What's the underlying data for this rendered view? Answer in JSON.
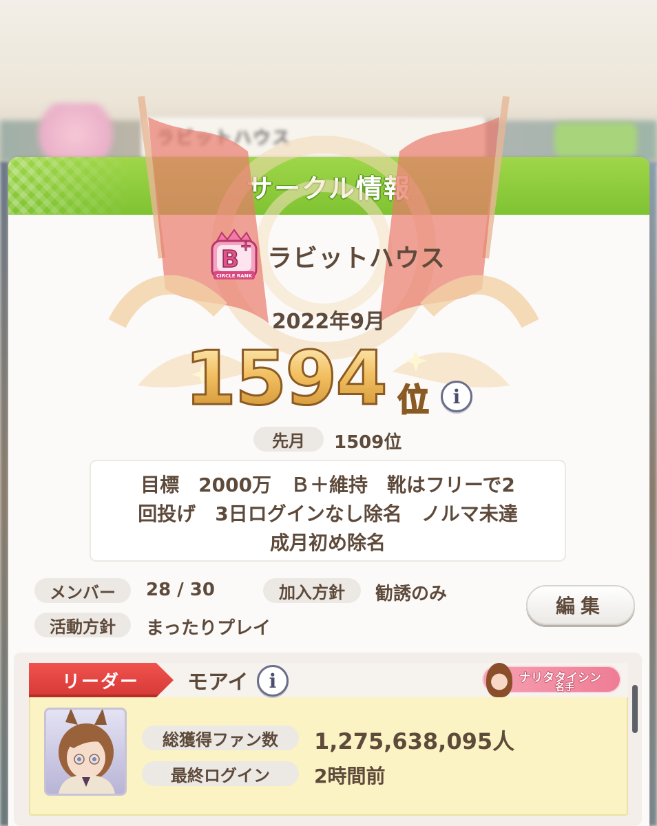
{
  "background": {
    "circle_name_blurred": "ラビットハウス"
  },
  "dialog": {
    "title": "サークル情報"
  },
  "circle": {
    "rank_badge": {
      "letter": "B",
      "plus": "+",
      "caption": "CIRCLE RANK",
      "color": "#e45f8f"
    },
    "name": "ラビットハウス",
    "month": "2022年9月",
    "rank_value": "1594",
    "rank_suffix": "位",
    "last_month_label": "先月",
    "last_month_value": "1509位",
    "description": "目標　2000万　Ｂ＋維持　靴はフリーで2\n回投げ　3日ログインなし除名　ノルマ未達\n成月初め除名",
    "members_label": "メンバー",
    "members_value": "28 / 30",
    "join_policy_label": "加入方針",
    "join_policy_value": "勧誘のみ",
    "activity_label": "活動方針",
    "activity_value": "まったりプレイ",
    "edit_label": "編集"
  },
  "leader": {
    "ribbon_label": "リーダー",
    "name": "モアイ",
    "title_badge_line1": "ナリタタイシン",
    "title_badge_line2": "名手",
    "fans_label": "総獲得ファン数",
    "fans_value": "1,275,638,095人",
    "last_login_label": "最終ログイン",
    "last_login_value": "2時間前"
  },
  "icons": {
    "info": "i",
    "rank_badge": "rank-badge-icon",
    "avatar": "character-portrait",
    "emblem": "flags-emblem"
  },
  "colors": {
    "header_green": "#8cc83a",
    "ribbon_red": "#e54844",
    "gold": "#f2c062",
    "card_yellow": "#fbf3c4"
  }
}
